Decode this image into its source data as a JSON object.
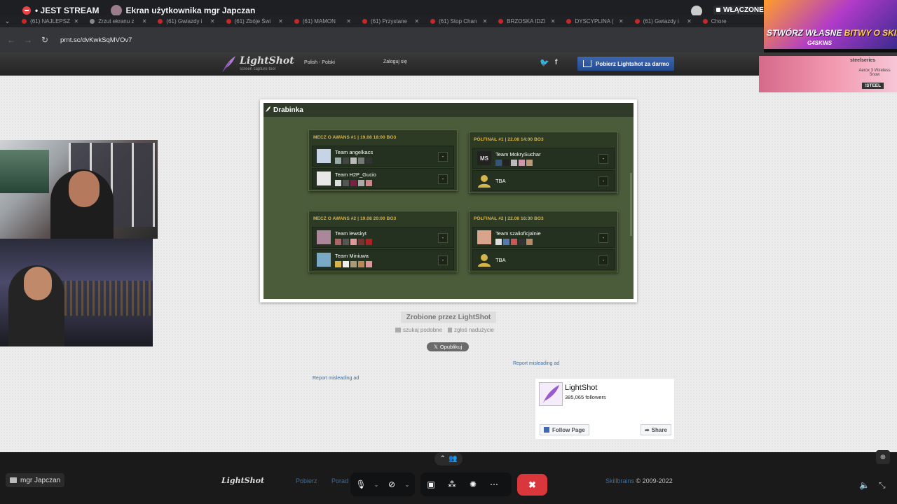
{
  "discord": {
    "stream_label": "• JEST STREAM",
    "viewing": "Ekran użytkownika mgr Japczan",
    "toggle": "WŁĄCZONE",
    "user_tag": "mgr Japczan"
  },
  "browser": {
    "tabs": [
      "(61) NAJLEPSZ",
      "Zrzut ekranu z",
      "(61) Gwiazdy i",
      "(61) Zbóje Świ",
      "(61) MAMON",
      "(61) Przystane",
      "(61) Stop Chan",
      "BRZOSKA IDZI",
      "DYSCYPLINA (",
      "(61) Gwiazdy i",
      "Chore"
    ],
    "url": "prnt.sc/dvKwkSqMVOv7"
  },
  "lightshot": {
    "logo": "LightShot",
    "tagline": "screen capture tool",
    "lang": "Polish - Polski",
    "login": "Zaloguj się",
    "download": "Pobierz Lightshot za darmo",
    "made_by": "Zrobione przez LightShot",
    "search_similar": "szukaj podobne",
    "report_abuse": "zgłoś nadużycie",
    "publish": "Opublikuj",
    "report_ad_1": "Report misleading ad",
    "report_ad_2": "Report misleading ad",
    "footer_logo": "LightShot",
    "footer_link_1": "Pobierz",
    "footer_link_2": "Porad",
    "footer_brand": "Skillbrains",
    "footer_copy": "© 2009-2022"
  },
  "bracket": {
    "title": "Drabinka",
    "matches": [
      {
        "title": "MECZ O AWANS #1 | 19.08 18:00 BO3",
        "teams": [
          {
            "name": "Team angelkacs",
            "score": "-"
          },
          {
            "name": "Team H2P_Gucio",
            "score": "-"
          }
        ]
      },
      {
        "title": "PÓŁFINAŁ #1 | 22.08 14:00 BO3",
        "teams": [
          {
            "name": "Team MokrySuchar",
            "score": "-",
            "avatar": "MS"
          },
          {
            "name": "TBA",
            "score": "-"
          }
        ]
      },
      {
        "title": "MECZ O AWANS #2 | 19.08 20:00 BO3",
        "teams": [
          {
            "name": "Team lewskyt",
            "score": "-"
          },
          {
            "name": "Team Miniuwa",
            "score": "-"
          }
        ]
      },
      {
        "title": "PÓŁFINAŁ #2 | 22.08 16:30 BO3",
        "teams": [
          {
            "name": "Team szalioficjalnie",
            "score": "-"
          },
          {
            "name": "TBA",
            "score": "-"
          }
        ]
      }
    ]
  },
  "facebook": {
    "name": "LightShot",
    "followers": "385,065 followers",
    "follow": "Follow Page",
    "share": "Share"
  },
  "ads": {
    "skins_prefix": "STWÓRZ WŁASNE",
    "skins_highlight": "BITWY O SKINY!",
    "skins_brand": "G4SKINS",
    "steelseries": "steelseries",
    "product": "Aerox 3 Wireless Snow",
    "cta": "!STEEL"
  },
  "colors": {
    "bracket_bg": "#4b5c3b",
    "match_title": "#d6b44b",
    "leave_red": "#da373c",
    "link_blue": "#3a6ea5"
  }
}
